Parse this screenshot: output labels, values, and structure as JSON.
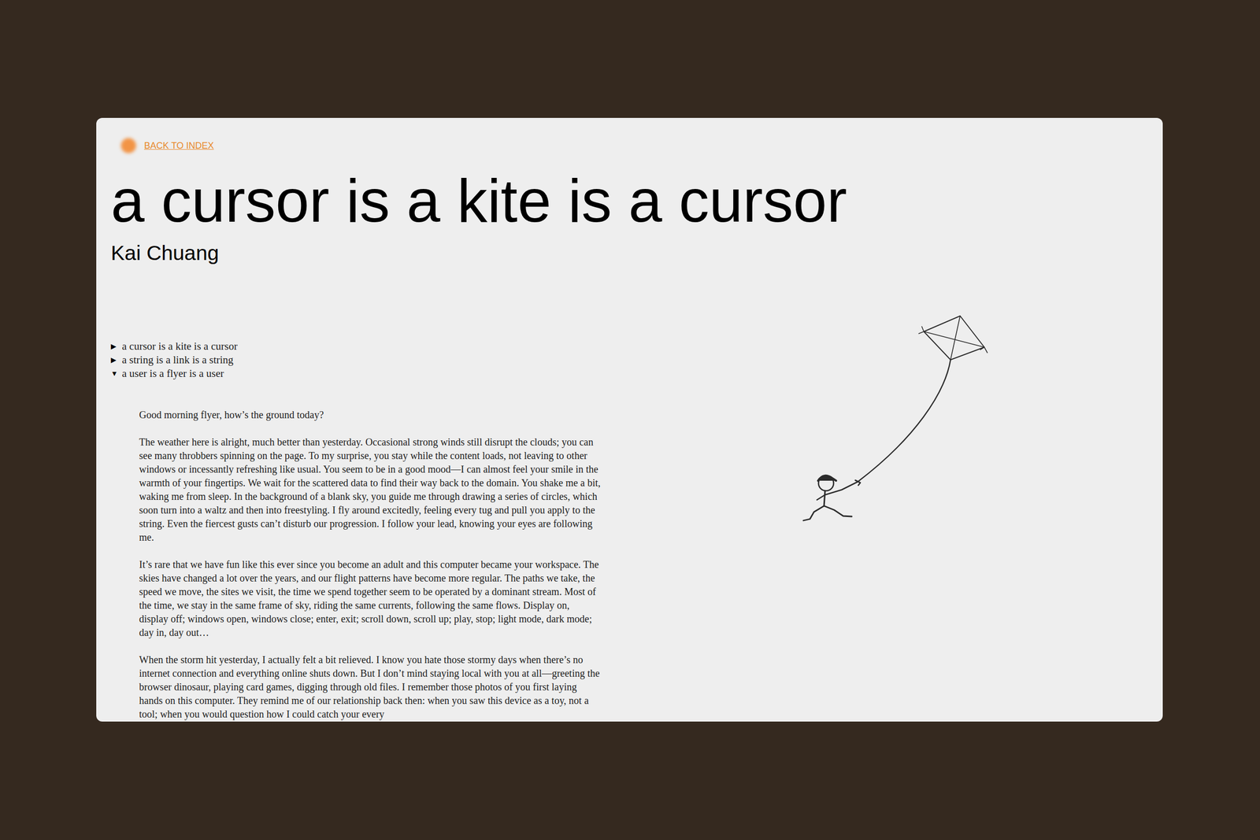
{
  "link": {
    "label": "BACK TO INDEX"
  },
  "title": "a cursor is a kite is a cursor",
  "author": "Kai Chuang",
  "sections": [
    {
      "marker": "▶",
      "label": "a cursor is a kite is a cursor",
      "expanded": false
    },
    {
      "marker": "▶",
      "label": "a string is a link is a string",
      "expanded": false
    },
    {
      "marker": "▼",
      "label": "a user is a flyer is a user",
      "expanded": true
    }
  ],
  "paragraphs": [
    "Good morning flyer, how’s the ground today?",
    "The weather here is alright, much better than yesterday. Occasional strong winds still disrupt the clouds; you can see many throbbers spinning on the page. To my surprise, you stay while the content loads, not leaving to other windows or incessantly refreshing like usual. You seem to be in a good mood—I can almost feel your smile in the warmth of your fingertips. We wait for the scattered data to find their way back to the domain. You shake me a bit, waking me from sleep. In the background of a blank sky, you guide me through drawing a series of circles, which soon turn into a waltz and then into freestyling. I fly around excitedly, feeling every tug and pull you apply to the string. Even the fiercest gusts can’t disturb our progression. I follow your lead, knowing your eyes are following me.",
    "It’s rare that we have fun like this ever since you become an adult and this computer became your workspace. The skies have changed a lot over the years, and our flight patterns have become more regular. The paths we take, the speed we move, the sites we visit, the time we spend together seem to be operated by a dominant stream. Most of the time, we stay in the same frame of sky, riding the same currents, following the same flows. Display on, display off; windows open, windows close; enter, exit; scroll down, scroll up; play, stop; light mode, dark mode; day in, day out…",
    "When the storm hit yesterday, I actually felt a bit relieved. I know you hate those stormy days when there’s no internet connection and everything online shuts down. But I don’t mind staying local with you at all—greeting the browser dinosaur, playing card games, digging through old files. I remember those photos of you first laying hands on this computer. They remind me of our relationship back then: when you saw this device as a toy, not a tool; when you would question how I could catch your every"
  ]
}
